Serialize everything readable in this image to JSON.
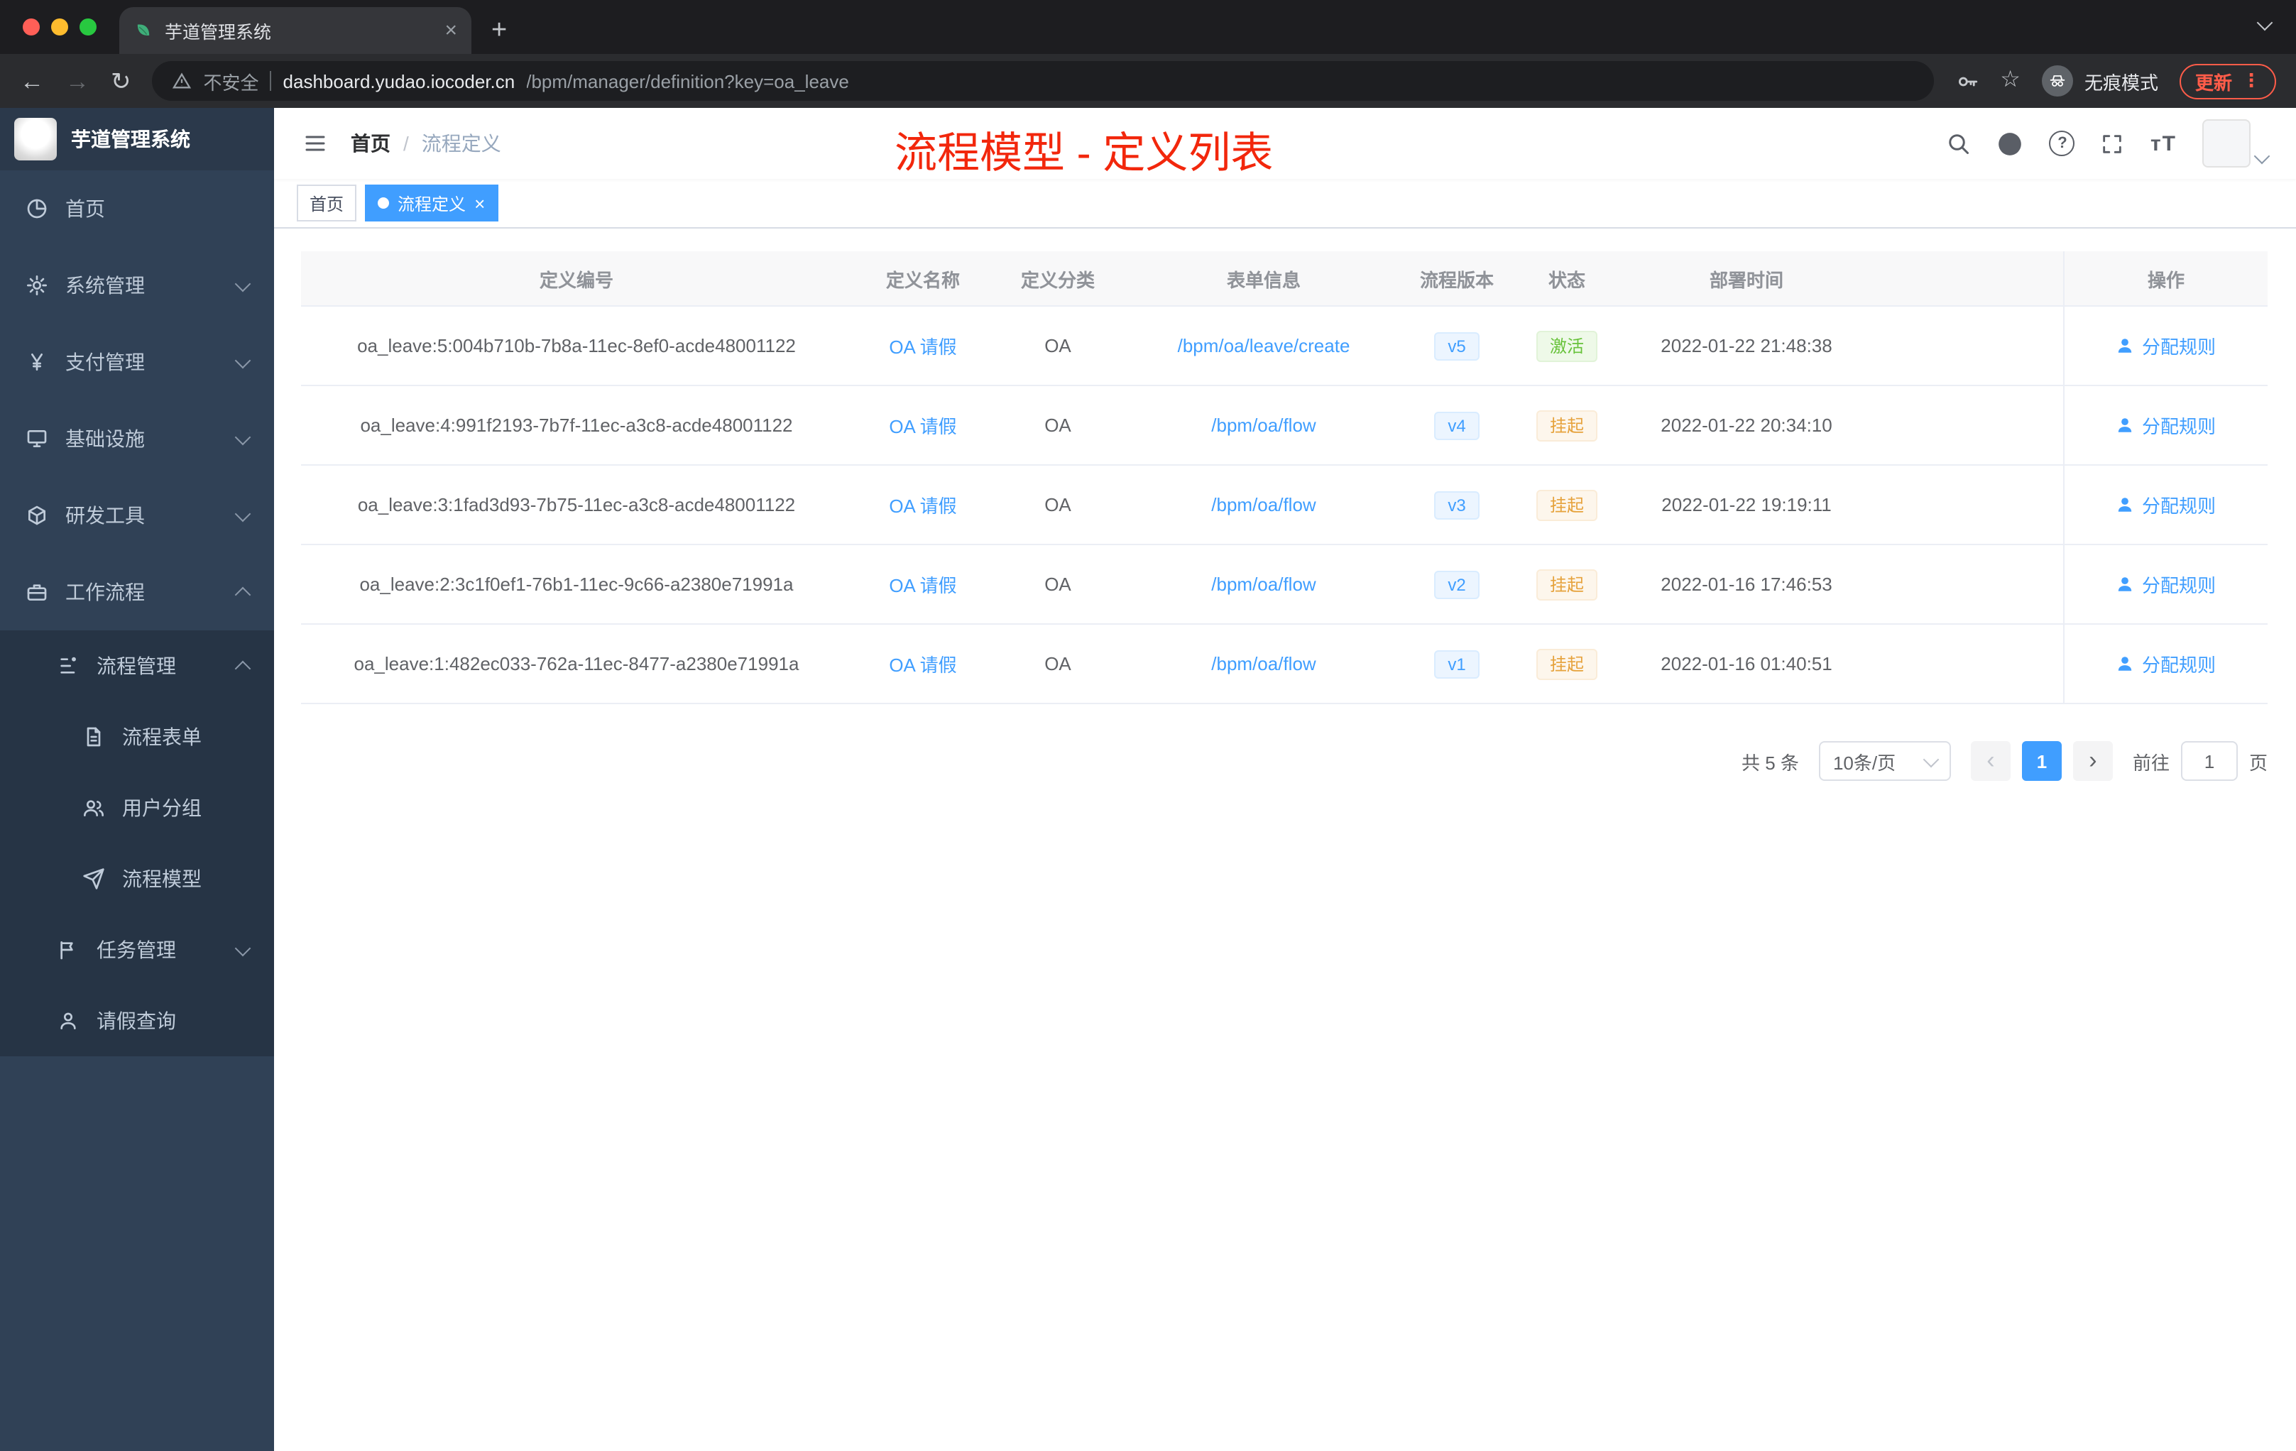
{
  "browser": {
    "tab_title": "芋道管理系统",
    "security_label": "不安全",
    "url_host": "dashboard.yudao.iocoder.cn",
    "url_path": "/bpm/manager/definition?key=oa_leave",
    "incognito_label": "无痕模式",
    "update_label": "更新"
  },
  "icons": {
    "tab_close": "×",
    "new_tab": "+",
    "back": "←",
    "forward": "→",
    "reload": "↻",
    "star": "☆",
    "menu_dots": "⋮",
    "prev": "‹",
    "next": "›",
    "tag_close": "×",
    "font_size": "тT"
  },
  "sidebar": {
    "logo_title": "芋道管理系统",
    "items": {
      "home": "首页",
      "system": "系统管理",
      "payment": "支付管理",
      "infra": "基础设施",
      "devtools": "研发工具",
      "workflow": "工作流程",
      "process_mgmt": "流程管理",
      "process_form": "流程表单",
      "user_group": "用户分组",
      "process_model": "流程模型",
      "task_mgmt": "任务管理",
      "leave_query": "请假查询"
    }
  },
  "header": {
    "breadcrumb": {
      "home": "首页",
      "sep": "/",
      "current": "流程定义"
    },
    "annotation": "流程模型 - 定义列表"
  },
  "tags": {
    "home": "首页",
    "active": "流程定义"
  },
  "table": {
    "columns": [
      "定义编号",
      "定义名称",
      "定义分类",
      "表单信息",
      "流程版本",
      "状态",
      "部署时间",
      "操作"
    ],
    "rows": [
      {
        "id": "oa_leave:5:004b710b-7b8a-11ec-8ef0-acde48001122",
        "name": "OA 请假",
        "category": "OA",
        "form": "/bpm/oa/leave/create",
        "version": "v5",
        "status": "激活",
        "status_type": "success",
        "time": "2022-01-22 21:48:38",
        "action": "分配规则"
      },
      {
        "id": "oa_leave:4:991f2193-7b7f-11ec-a3c8-acde48001122",
        "name": "OA 请假",
        "category": "OA",
        "form": "/bpm/oa/flow",
        "version": "v4",
        "status": "挂起",
        "status_type": "warning",
        "time": "2022-01-22 20:34:10",
        "action": "分配规则"
      },
      {
        "id": "oa_leave:3:1fad3d93-7b75-11ec-a3c8-acde48001122",
        "name": "OA 请假",
        "category": "OA",
        "form": "/bpm/oa/flow",
        "version": "v3",
        "status": "挂起",
        "status_type": "warning",
        "time": "2022-01-22 19:19:11",
        "action": "分配规则"
      },
      {
        "id": "oa_leave:2:3c1f0ef1-76b1-11ec-9c66-a2380e71991a",
        "name": "OA 请假",
        "category": "OA",
        "form": "/bpm/oa/flow",
        "version": "v2",
        "status": "挂起",
        "status_type": "warning",
        "time": "2022-01-16 17:46:53",
        "action": "分配规则"
      },
      {
        "id": "oa_leave:1:482ec033-762a-11ec-8477-a2380e71991a",
        "name": "OA 请假",
        "category": "OA",
        "form": "/bpm/oa/flow",
        "version": "v1",
        "status": "挂起",
        "status_type": "warning",
        "time": "2022-01-16 01:40:51",
        "action": "分配规则"
      }
    ]
  },
  "pagination": {
    "total": "共 5 条",
    "page_size": "10条/页",
    "current_page": "1",
    "goto_label": "前往",
    "goto_value": "1",
    "page_unit": "页"
  },
  "colors": {
    "accent_blue": "#409eff",
    "status_active_green": "#67c23a",
    "status_suspend_orange": "#e6a23c",
    "annotation_red": "#f2270c",
    "sidebar_bg": "#304156"
  }
}
